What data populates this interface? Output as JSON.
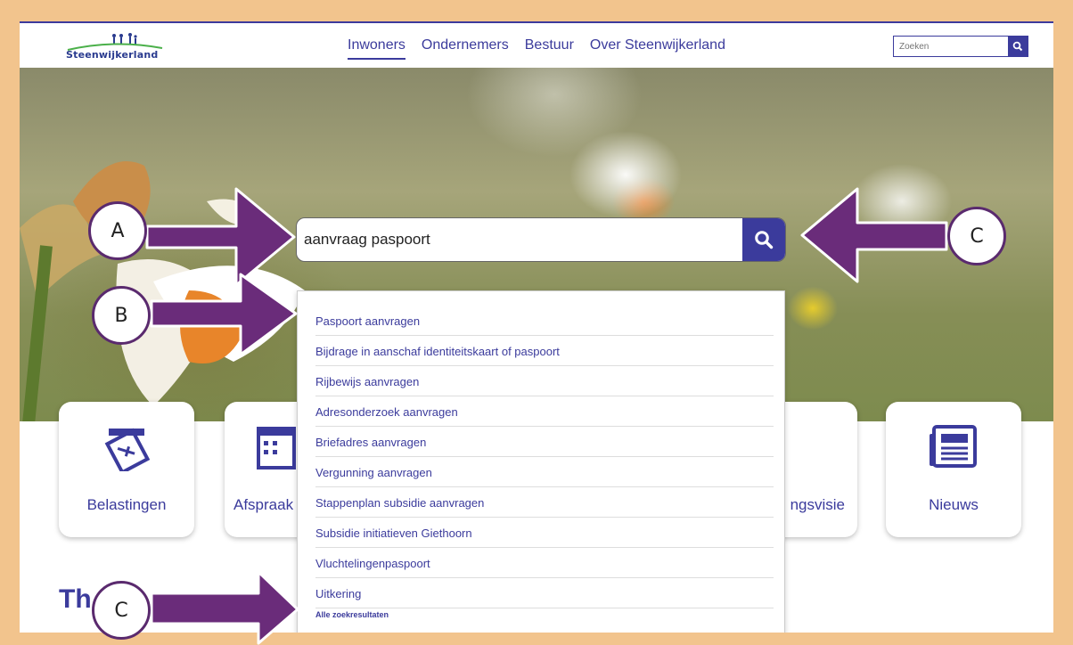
{
  "header": {
    "logo_text": "Steenwijkerland",
    "nav": [
      "Inwoners",
      "Ondernemers",
      "Bestuur",
      "Over Steenwijkerland"
    ],
    "search_placeholder": "Zoeken"
  },
  "search": {
    "value": "aanvraag paspoort"
  },
  "suggestions": [
    "Paspoort aanvragen",
    "Bijdrage in aanschaf identiteitskaart of paspoort",
    "Rijbewijs aanvragen",
    "Adresonderzoek aanvragen",
    "Briefadres aanvragen",
    "Vergunning aanvragen",
    "Stappenplan subsidie aanvragen",
    "Subsidie initiatieven Giethoorn",
    "Vluchtelingenpaspoort",
    "Uitkering"
  ],
  "all_results_label": "Alle zoekresultaten",
  "tiles": {
    "belastingen": "Belastingen",
    "afspraak": "Afspraak",
    "omgevingsvisie": "ngsvisie",
    "nieuws": "Nieuws"
  },
  "themes_heading": "Th",
  "annotations": {
    "a": "A",
    "b": "B",
    "c1": "C",
    "c2": "C"
  },
  "colors": {
    "brand": "#3b3b9c",
    "arrow": "#6a2c7a",
    "frame": "#f2c48d"
  }
}
